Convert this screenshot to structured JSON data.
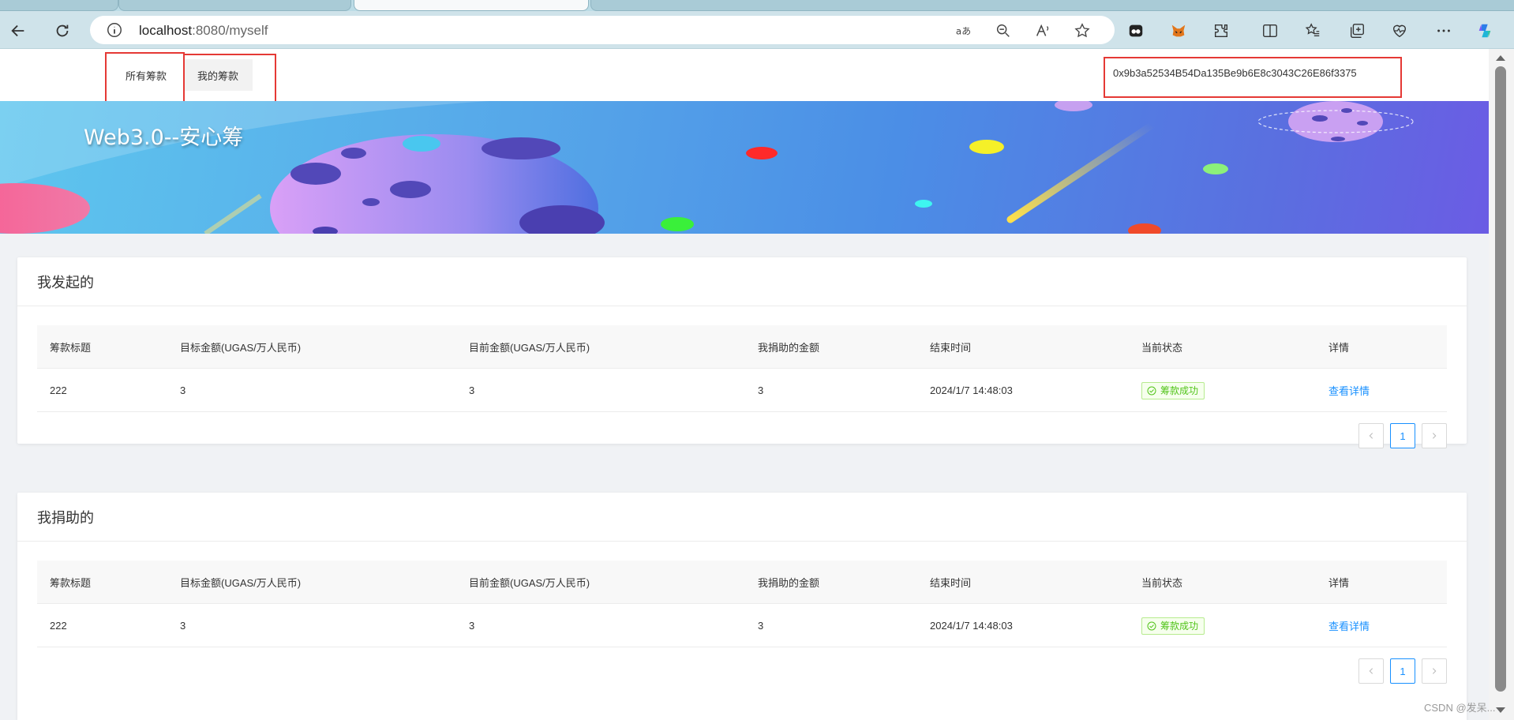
{
  "browser": {
    "url_host": "localhost",
    "url_rest": ":8080/myself"
  },
  "nav": {
    "items": [
      {
        "label": "所有筹款"
      },
      {
        "label": "我的筹款"
      }
    ],
    "account_address": "0x9b3a52534B54Da135Be9b6E8c3043C26E86f3375"
  },
  "banner": {
    "title": "Web3.0--安心筹"
  },
  "columns": [
    "筹款标题",
    "目标金额(UGAS/万人民币)",
    "目前金额(UGAS/万人民币)",
    "我捐助的金额",
    "结束时间",
    "当前状态",
    "详情"
  ],
  "sections": [
    {
      "title": "我发起的",
      "rows": [
        {
          "title": "222",
          "target": "3",
          "current": "3",
          "donated": "3",
          "end_time": "2024/1/7 14:48:03",
          "status": "筹款成功",
          "detail": "查看详情"
        }
      ],
      "page": "1"
    },
    {
      "title": "我捐助的",
      "rows": [
        {
          "title": "222",
          "target": "3",
          "current": "3",
          "donated": "3",
          "end_time": "2024/1/7 14:48:03",
          "status": "筹款成功",
          "detail": "查看详情"
        }
      ],
      "page": "1"
    }
  ],
  "watermark": "CSDN @发呆...",
  "colors": {
    "accent": "#1890ff",
    "success": "#52c41a",
    "highlight_box": "#e53935"
  }
}
